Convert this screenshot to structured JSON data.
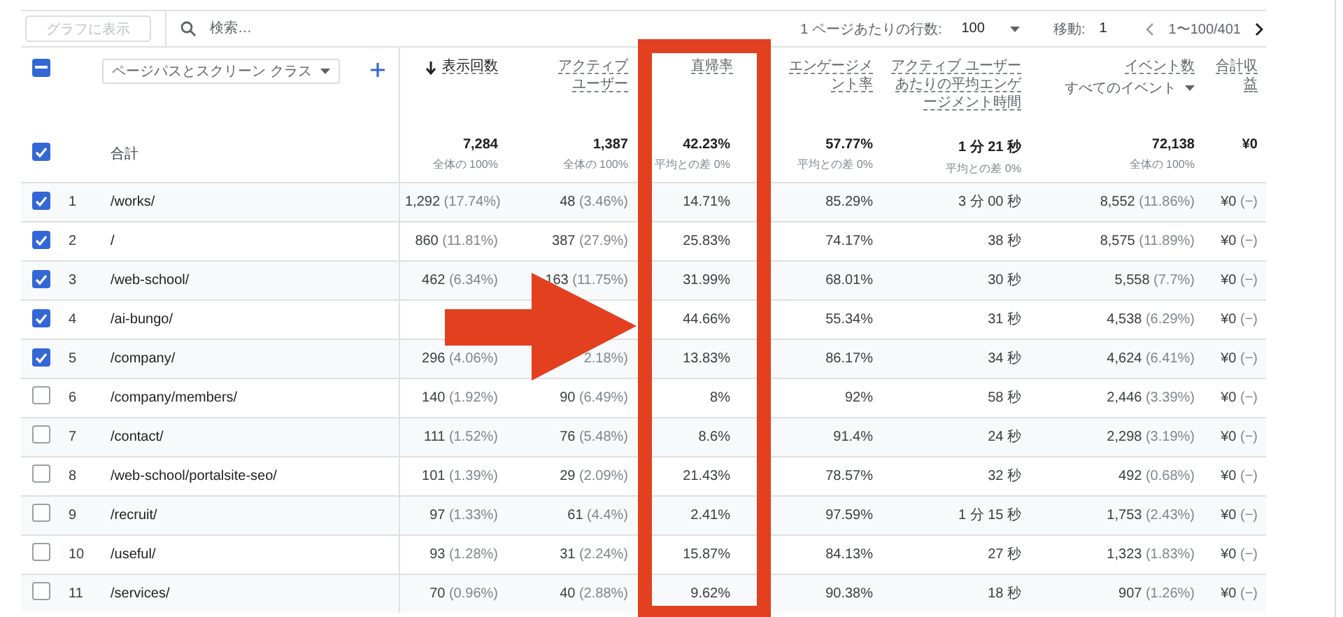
{
  "toolbar": {
    "graph_button": "グラフに表示",
    "search_placeholder": "検索…",
    "rows_per_page_label": "1 ページあたりの行数:",
    "rows_per_page": "100",
    "goto_label": "移動:",
    "goto_value": "1",
    "range": "1〜100/401"
  },
  "header": {
    "select_all_indeterminate": true,
    "dimension": "ページパスとスクリーン クラス",
    "metrics": [
      {
        "label": "表示回数",
        "sorted": true,
        "highlighted": false
      },
      {
        "label": "アクティブユーザー",
        "sorted": false,
        "highlighted": false
      },
      {
        "label": "直帰率",
        "sorted": false,
        "highlighted": true
      },
      {
        "label": "エンゲージメント率",
        "sorted": false,
        "highlighted": false
      },
      {
        "label": "アクティブ ユーザーあたりの平均エンゲージメント時間",
        "sorted": false,
        "highlighted": false
      },
      {
        "label": "イベント数",
        "sublabel": "すべてのイベント",
        "sorted": false,
        "highlighted": false
      },
      {
        "label": "合計収益",
        "sorted": false,
        "highlighted": false
      }
    ]
  },
  "total": {
    "label": "合計",
    "checked": true,
    "values": [
      {
        "value": "7,284",
        "sub": "全体の 100%"
      },
      {
        "value": "1,387",
        "sub": "全体の 100%"
      },
      {
        "value": "42.23%",
        "sub": "平均との差 0%"
      },
      {
        "value": "57.77%",
        "sub": "平均との差 0%"
      },
      {
        "value": "1 分 21 秒",
        "sub": "平均との差 0%"
      },
      {
        "value": "72,138",
        "sub": "全体の 100%"
      },
      {
        "value": "¥0"
      }
    ]
  },
  "rows": [
    {
      "index": "1",
      "page": "/works/",
      "checked": true,
      "cells": [
        [
          "1,292",
          "(17.74%)"
        ],
        [
          "48",
          "(3.46%)"
        ],
        [
          "14.71%"
        ],
        [
          "85.29%"
        ],
        [
          "3 分 00 秒"
        ],
        [
          "8,552",
          "(11.86%)"
        ],
        [
          "¥0",
          "(−)"
        ]
      ]
    },
    {
      "index": "2",
      "page": "/",
      "checked": true,
      "cells": [
        [
          "860",
          "(11.81%)"
        ],
        [
          "387",
          "(27.9%)"
        ],
        [
          "25.83%"
        ],
        [
          "74.17%"
        ],
        [
          "38 秒"
        ],
        [
          "8,575",
          "(11.89%)"
        ],
        [
          "¥0",
          "(−)"
        ]
      ]
    },
    {
      "index": "3",
      "page": "/web-school/",
      "checked": true,
      "cells": [
        [
          "462",
          "(6.34%)"
        ],
        [
          "163",
          "(11.75%)"
        ],
        [
          "31.99%"
        ],
        [
          "68.01%"
        ],
        [
          "30 秒"
        ],
        [
          "5,558",
          "(7.7%)"
        ],
        [
          "¥0",
          "(−)"
        ]
      ]
    },
    {
      "index": "4",
      "page": "/ai-bungo/",
      "checked": true,
      "cells": [
        [],
        [],
        [
          "44.66%"
        ],
        [
          "55.34%"
        ],
        [
          "31 秒"
        ],
        [
          "4,538",
          "(6.29%)"
        ],
        [
          "¥0",
          "(−)"
        ]
      ]
    },
    {
      "index": "5",
      "page": "/company/",
      "checked": true,
      "cells": [
        [
          "296",
          "(4.06%)"
        ],
        [
          "",
          "2.18%)"
        ],
        [
          "13.83%"
        ],
        [
          "86.17%"
        ],
        [
          "34 秒"
        ],
        [
          "4,624",
          "(6.41%)"
        ],
        [
          "¥0",
          "(−)"
        ]
      ]
    },
    {
      "index": "6",
      "page": "/company/members/",
      "checked": false,
      "cells": [
        [
          "140",
          "(1.92%)"
        ],
        [
          "90",
          "(6.49%)"
        ],
        [
          "8%"
        ],
        [
          "92%"
        ],
        [
          "58 秒"
        ],
        [
          "2,446",
          "(3.39%)"
        ],
        [
          "¥0",
          "(−)"
        ]
      ]
    },
    {
      "index": "7",
      "page": "/contact/",
      "checked": false,
      "cells": [
        [
          "111",
          "(1.52%)"
        ],
        [
          "76",
          "(5.48%)"
        ],
        [
          "8.6%"
        ],
        [
          "91.4%"
        ],
        [
          "24 秒"
        ],
        [
          "2,298",
          "(3.19%)"
        ],
        [
          "¥0",
          "(−)"
        ]
      ]
    },
    {
      "index": "8",
      "page": "/web-school/portalsite-seo/",
      "checked": false,
      "cells": [
        [
          "101",
          "(1.39%)"
        ],
        [
          "29",
          "(2.09%)"
        ],
        [
          "21.43%"
        ],
        [
          "78.57%"
        ],
        [
          "32 秒"
        ],
        [
          "492",
          "(0.68%)"
        ],
        [
          "¥0",
          "(−)"
        ]
      ]
    },
    {
      "index": "9",
      "page": "/recruit/",
      "checked": false,
      "cells": [
        [
          "97",
          "(1.33%)"
        ],
        [
          "61",
          "(4.4%)"
        ],
        [
          "2.41%"
        ],
        [
          "97.59%"
        ],
        [
          "1 分 15 秒"
        ],
        [
          "1,753",
          "(2.43%)"
        ],
        [
          "¥0",
          "(−)"
        ]
      ]
    },
    {
      "index": "10",
      "page": "/useful/",
      "checked": false,
      "cells": [
        [
          "93",
          "(1.28%)"
        ],
        [
          "31",
          "(2.24%)"
        ],
        [
          "15.87%"
        ],
        [
          "84.13%"
        ],
        [
          "27 秒"
        ],
        [
          "1,323",
          "(1.83%)"
        ],
        [
          "¥0",
          "(−)"
        ]
      ]
    },
    {
      "index": "11",
      "page": "/services/",
      "checked": false,
      "cells": [
        [
          "70",
          "(0.96%)"
        ],
        [
          "40",
          "(2.88%)"
        ],
        [
          "9.62%"
        ],
        [
          "90.38%"
        ],
        [
          "18 秒"
        ],
        [
          "907",
          "(1.26%)"
        ],
        [
          "¥0",
          "(−)"
        ]
      ]
    }
  ]
}
